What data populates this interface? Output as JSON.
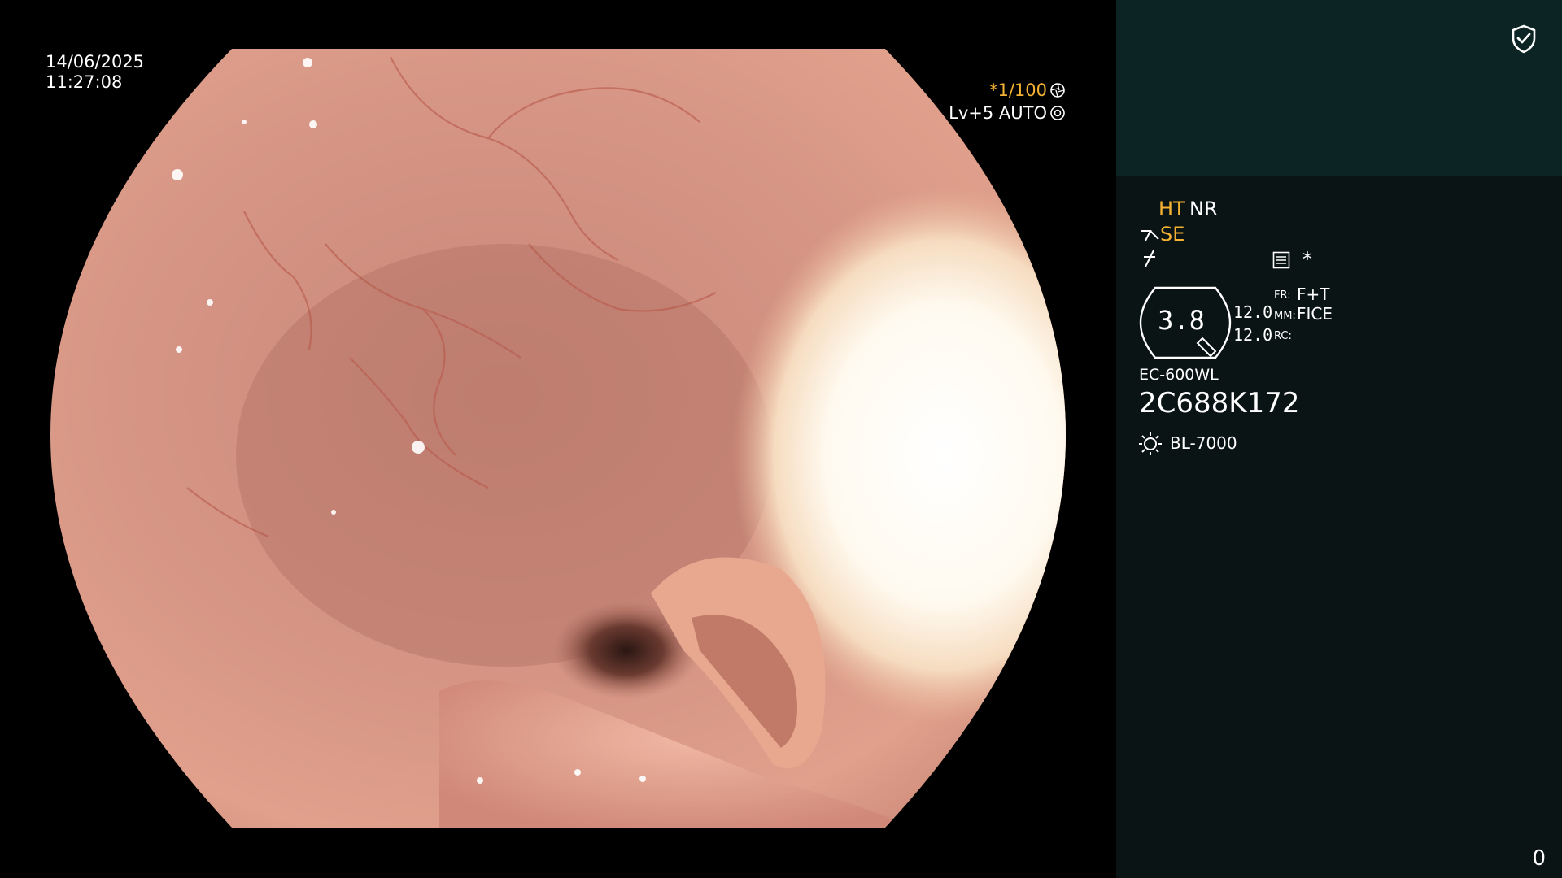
{
  "osd": {
    "date": "14/06/2025",
    "time": "11:27:08",
    "shutter": "*1/100",
    "level": "Lv+5 AUTO"
  },
  "panel": {
    "ht": "HT",
    "nr": "NR",
    "se": "SE",
    "asterisk": "*",
    "gauge_value": "3.8",
    "value_1": "12.0",
    "value_2": "12.0",
    "fr_label": "FR:",
    "fr_value": "F+T",
    "mm_label": "MM:",
    "mm_value": "FICE",
    "rc_label": "RC:",
    "model": "EC-600WL",
    "serial": "2C688K172",
    "light_source": "BL-7000",
    "counter": "0"
  },
  "colors": {
    "accent_orange": "#f5b233",
    "panel_top": "#0d2425",
    "panel_bg": "#0a1414"
  },
  "icons": [
    "shield-check-icon",
    "aperture-icon",
    "settings-icon",
    "se-arrow-icon",
    "f-slash-icon",
    "menu-icon",
    "gauge-icon",
    "sun-icon"
  ]
}
